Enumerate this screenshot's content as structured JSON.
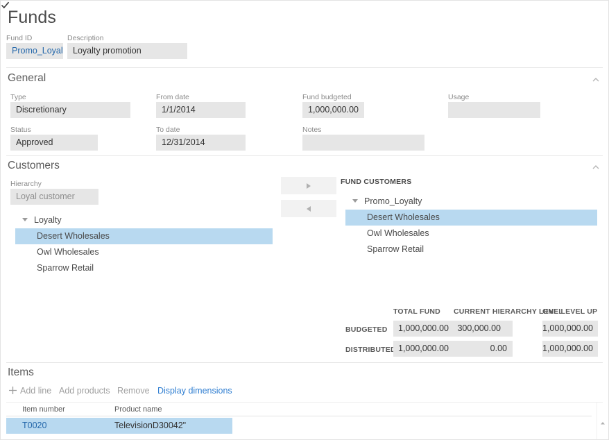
{
  "page": {
    "title": "Funds"
  },
  "header": {
    "fund_id_label": "Fund ID",
    "fund_id_value": "Promo_Loyalty",
    "description_label": "Description",
    "description_value": "Loyalty promotion"
  },
  "general": {
    "section_title": "General",
    "collapse_icon": "chevron-up-icon",
    "type_label": "Type",
    "type_value": "Discretionary",
    "from_date_label": "From date",
    "from_date_value": "1/1/2014",
    "fund_budgeted_label": "Fund budgeted",
    "fund_budgeted_value": "1,000,000.00",
    "usage_label": "Usage",
    "usage_value": "",
    "status_label": "Status",
    "status_value": "Approved",
    "to_date_label": "To date",
    "to_date_value": "12/31/2014",
    "notes_label": "Notes",
    "notes_value": ""
  },
  "customers": {
    "section_title": "Customers",
    "collapse_icon": "chevron-up-icon",
    "hierarchy_label": "Hierarchy",
    "hierarchy_value": "Loyal customer",
    "move_right_label": ">",
    "move_left_label": "<",
    "available_tree": [
      {
        "label": "Loyalty",
        "type": "node",
        "selected": false
      },
      {
        "label": "Desert Wholesales",
        "type": "leaf",
        "selected": true
      },
      {
        "label": "Owl Wholesales",
        "type": "leaf",
        "selected": false
      },
      {
        "label": "Sparrow Retail",
        "type": "leaf",
        "selected": false
      }
    ],
    "fund_customers_header": "FUND CUSTOMERS",
    "fund_customers_tree": [
      {
        "label": "Promo_Loyalty",
        "type": "node",
        "selected": false
      },
      {
        "label": "Desert Wholesales",
        "type": "leaf",
        "selected": true
      },
      {
        "label": "Owl Wholesales",
        "type": "leaf",
        "selected": false
      },
      {
        "label": "Sparrow Retail",
        "type": "leaf",
        "selected": false
      }
    ],
    "budget_matrix": {
      "column_headers": [
        "TOTAL FUND",
        "CURRENT HIERARCHY LEVEL",
        "ONE LEVEL UP"
      ],
      "row_headers": [
        "BUDGETED",
        "DISTRIBUTED"
      ],
      "rows": [
        [
          "1,000,000.00",
          "300,000.00",
          "1,000,000.00"
        ],
        [
          "1,000,000.00",
          "0.00",
          "1,000,000.00"
        ]
      ]
    }
  },
  "items": {
    "section_title": "Items",
    "toolbar": {
      "add_icon": "plus-icon",
      "add_line": "Add line",
      "add_products": "Add products",
      "remove": "Remove",
      "display_dimensions": "Display dimensions"
    },
    "grid": {
      "select_all_icon": "checkmark-icon",
      "columns": [
        "Item number",
        "Product name"
      ],
      "rows": [
        {
          "item_number": "T0020",
          "product_name": "TelevisionD30042\"",
          "selected": true
        }
      ]
    },
    "scrollbar": {
      "up_arrow_icon": "triangle-up-icon"
    }
  },
  "colors": {
    "accent_link": "#2266aa",
    "toolbar_link": "#2f7ed1",
    "selection": "#b8d9f0",
    "field_background": "#e6e6e6"
  }
}
